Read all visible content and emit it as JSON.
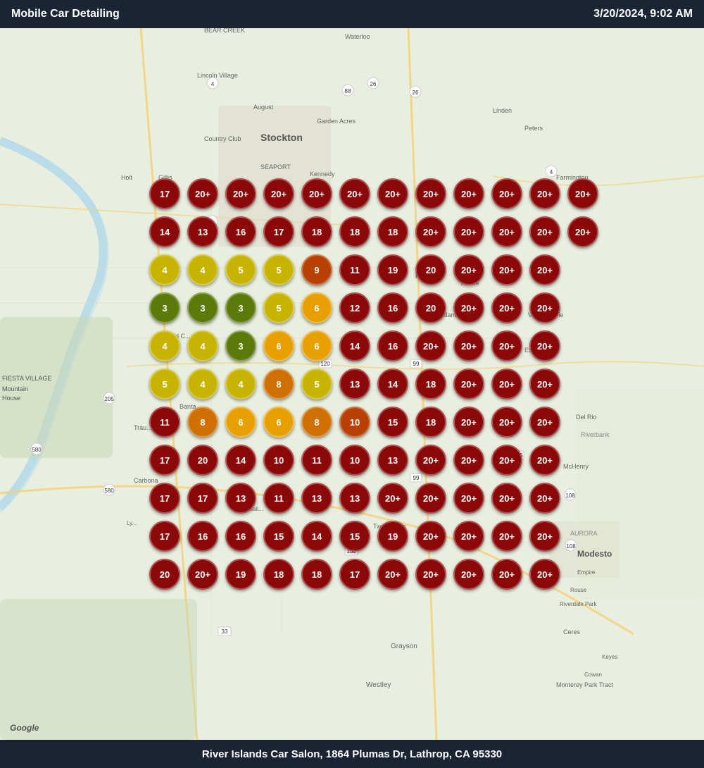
{
  "header": {
    "title": "Mobile Car Detailing",
    "datetime": "3/20/2024, 9:02 AM"
  },
  "footer": {
    "address": "River Islands Car Salon, 1864 Plumas Dr, Lathrop, CA 95330"
  },
  "google_logo": "Google",
  "bubbles": [
    {
      "row": 0,
      "col": 0,
      "val": "17",
      "color": "dark-red"
    },
    {
      "row": 0,
      "col": 1,
      "val": "20+",
      "color": "dark-red"
    },
    {
      "row": 0,
      "col": 2,
      "val": "20+",
      "color": "dark-red"
    },
    {
      "row": 0,
      "col": 3,
      "val": "20+",
      "color": "dark-red"
    },
    {
      "row": 0,
      "col": 4,
      "val": "20+",
      "color": "dark-red"
    },
    {
      "row": 0,
      "col": 5,
      "val": "20+",
      "color": "dark-red"
    },
    {
      "row": 0,
      "col": 6,
      "val": "20+",
      "color": "dark-red"
    },
    {
      "row": 0,
      "col": 7,
      "val": "20+",
      "color": "dark-red"
    },
    {
      "row": 0,
      "col": 8,
      "val": "20+",
      "color": "dark-red"
    },
    {
      "row": 0,
      "col": 9,
      "val": "20+",
      "color": "dark-red"
    },
    {
      "row": 0,
      "col": 10,
      "val": "20+",
      "color": "dark-red"
    },
    {
      "row": 0,
      "col": 11,
      "val": "20+",
      "color": "dark-red"
    },
    {
      "row": 1,
      "col": 0,
      "val": "14",
      "color": "dark-red"
    },
    {
      "row": 1,
      "col": 1,
      "val": "13",
      "color": "dark-red"
    },
    {
      "row": 1,
      "col": 2,
      "val": "16",
      "color": "dark-red"
    },
    {
      "row": 1,
      "col": 3,
      "val": "17",
      "color": "dark-red"
    },
    {
      "row": 1,
      "col": 4,
      "val": "18",
      "color": "dark-red"
    },
    {
      "row": 1,
      "col": 5,
      "val": "18",
      "color": "dark-red"
    },
    {
      "row": 1,
      "col": 6,
      "val": "18",
      "color": "dark-red"
    },
    {
      "row": 1,
      "col": 7,
      "val": "20+",
      "color": "dark-red"
    },
    {
      "row": 1,
      "col": 8,
      "val": "20+",
      "color": "dark-red"
    },
    {
      "row": 1,
      "col": 9,
      "val": "20+",
      "color": "dark-red"
    },
    {
      "row": 1,
      "col": 10,
      "val": "20+",
      "color": "dark-red"
    },
    {
      "row": 1,
      "col": 11,
      "val": "20+",
      "color": "dark-red"
    },
    {
      "row": 2,
      "col": 0,
      "val": "4",
      "color": "yellow"
    },
    {
      "row": 2,
      "col": 1,
      "val": "4",
      "color": "yellow"
    },
    {
      "row": 2,
      "col": 2,
      "val": "5",
      "color": "yellow"
    },
    {
      "row": 2,
      "col": 3,
      "val": "5",
      "color": "yellow"
    },
    {
      "row": 2,
      "col": 4,
      "val": "9",
      "color": "dark-orange"
    },
    {
      "row": 2,
      "col": 5,
      "val": "11",
      "color": "dark-red"
    },
    {
      "row": 2,
      "col": 6,
      "val": "19",
      "color": "dark-red"
    },
    {
      "row": 2,
      "col": 7,
      "val": "20",
      "color": "dark-red"
    },
    {
      "row": 2,
      "col": 8,
      "val": "20+",
      "color": "dark-red"
    },
    {
      "row": 2,
      "col": 9,
      "val": "20+",
      "color": "dark-red"
    },
    {
      "row": 2,
      "col": 10,
      "val": "20+",
      "color": "dark-red"
    },
    {
      "row": 3,
      "col": 0,
      "val": "3",
      "color": "olive"
    },
    {
      "row": 3,
      "col": 1,
      "val": "3",
      "color": "olive"
    },
    {
      "row": 3,
      "col": 2,
      "val": "3",
      "color": "olive"
    },
    {
      "row": 3,
      "col": 3,
      "val": "5",
      "color": "yellow"
    },
    {
      "row": 3,
      "col": 4,
      "val": "6",
      "color": "light-orange"
    },
    {
      "row": 3,
      "col": 5,
      "val": "12",
      "color": "dark-red"
    },
    {
      "row": 3,
      "col": 6,
      "val": "16",
      "color": "dark-red"
    },
    {
      "row": 3,
      "col": 7,
      "val": "20",
      "color": "dark-red"
    },
    {
      "row": 3,
      "col": 8,
      "val": "20+",
      "color": "dark-red"
    },
    {
      "row": 3,
      "col": 9,
      "val": "20+",
      "color": "dark-red"
    },
    {
      "row": 3,
      "col": 10,
      "val": "20+",
      "color": "dark-red"
    },
    {
      "row": 4,
      "col": 0,
      "val": "4",
      "color": "yellow"
    },
    {
      "row": 4,
      "col": 1,
      "val": "4",
      "color": "yellow"
    },
    {
      "row": 4,
      "col": 2,
      "val": "3",
      "color": "olive"
    },
    {
      "row": 4,
      "col": 3,
      "val": "6",
      "color": "light-orange"
    },
    {
      "row": 4,
      "col": 4,
      "val": "6",
      "color": "light-orange"
    },
    {
      "row": 4,
      "col": 5,
      "val": "14",
      "color": "dark-red"
    },
    {
      "row": 4,
      "col": 6,
      "val": "16",
      "color": "dark-red"
    },
    {
      "row": 4,
      "col": 7,
      "val": "20+",
      "color": "dark-red"
    },
    {
      "row": 4,
      "col": 8,
      "val": "20+",
      "color": "dark-red"
    },
    {
      "row": 4,
      "col": 9,
      "val": "20+",
      "color": "dark-red"
    },
    {
      "row": 4,
      "col": 10,
      "val": "20+",
      "color": "dark-red"
    },
    {
      "row": 5,
      "col": 0,
      "val": "5",
      "color": "yellow"
    },
    {
      "row": 5,
      "col": 1,
      "val": "4",
      "color": "yellow"
    },
    {
      "row": 5,
      "col": 2,
      "val": "4",
      "color": "yellow"
    },
    {
      "row": 5,
      "col": 3,
      "val": "8",
      "color": "orange"
    },
    {
      "row": 5,
      "col": 4,
      "val": "5",
      "color": "yellow"
    },
    {
      "row": 5,
      "col": 5,
      "val": "13",
      "color": "dark-red"
    },
    {
      "row": 5,
      "col": 6,
      "val": "14",
      "color": "dark-red"
    },
    {
      "row": 5,
      "col": 7,
      "val": "18",
      "color": "dark-red"
    },
    {
      "row": 5,
      "col": 8,
      "val": "20+",
      "color": "dark-red"
    },
    {
      "row": 5,
      "col": 9,
      "val": "20+",
      "color": "dark-red"
    },
    {
      "row": 5,
      "col": 10,
      "val": "20+",
      "color": "dark-red"
    },
    {
      "row": 6,
      "col": 0,
      "val": "11",
      "color": "dark-red"
    },
    {
      "row": 6,
      "col": 1,
      "val": "8",
      "color": "orange"
    },
    {
      "row": 6,
      "col": 2,
      "val": "6",
      "color": "light-orange"
    },
    {
      "row": 6,
      "col": 3,
      "val": "6",
      "color": "light-orange"
    },
    {
      "row": 6,
      "col": 4,
      "val": "8",
      "color": "orange"
    },
    {
      "row": 6,
      "col": 5,
      "val": "10",
      "color": "dark-orange"
    },
    {
      "row": 6,
      "col": 6,
      "val": "15",
      "color": "dark-red"
    },
    {
      "row": 6,
      "col": 7,
      "val": "18",
      "color": "dark-red"
    },
    {
      "row": 6,
      "col": 8,
      "val": "20+",
      "color": "dark-red"
    },
    {
      "row": 6,
      "col": 9,
      "val": "20+",
      "color": "dark-red"
    },
    {
      "row": 6,
      "col": 10,
      "val": "20+",
      "color": "dark-red"
    },
    {
      "row": 7,
      "col": 0,
      "val": "17",
      "color": "dark-red"
    },
    {
      "row": 7,
      "col": 1,
      "val": "20",
      "color": "dark-red"
    },
    {
      "row": 7,
      "col": 2,
      "val": "14",
      "color": "dark-red"
    },
    {
      "row": 7,
      "col": 3,
      "val": "10",
      "color": "dark-red"
    },
    {
      "row": 7,
      "col": 4,
      "val": "11",
      "color": "dark-red"
    },
    {
      "row": 7,
      "col": 5,
      "val": "10",
      "color": "dark-red"
    },
    {
      "row": 7,
      "col": 6,
      "val": "13",
      "color": "dark-red"
    },
    {
      "row": 7,
      "col": 7,
      "val": "20+",
      "color": "dark-red"
    },
    {
      "row": 7,
      "col": 8,
      "val": "20+",
      "color": "dark-red"
    },
    {
      "row": 7,
      "col": 9,
      "val": "20+",
      "color": "dark-red"
    },
    {
      "row": 7,
      "col": 10,
      "val": "20+",
      "color": "dark-red"
    },
    {
      "row": 8,
      "col": 0,
      "val": "17",
      "color": "dark-red"
    },
    {
      "row": 8,
      "col": 1,
      "val": "17",
      "color": "dark-red"
    },
    {
      "row": 8,
      "col": 2,
      "val": "13",
      "color": "dark-red"
    },
    {
      "row": 8,
      "col": 3,
      "val": "11",
      "color": "dark-red"
    },
    {
      "row": 8,
      "col": 4,
      "val": "13",
      "color": "dark-red"
    },
    {
      "row": 8,
      "col": 5,
      "val": "13",
      "color": "dark-red"
    },
    {
      "row": 8,
      "col": 6,
      "val": "20+",
      "color": "dark-red"
    },
    {
      "row": 8,
      "col": 7,
      "val": "20+",
      "color": "dark-red"
    },
    {
      "row": 8,
      "col": 8,
      "val": "20+",
      "color": "dark-red"
    },
    {
      "row": 8,
      "col": 9,
      "val": "20+",
      "color": "dark-red"
    },
    {
      "row": 8,
      "col": 10,
      "val": "20+",
      "color": "dark-red"
    },
    {
      "row": 9,
      "col": 0,
      "val": "17",
      "color": "dark-red"
    },
    {
      "row": 9,
      "col": 1,
      "val": "16",
      "color": "dark-red"
    },
    {
      "row": 9,
      "col": 2,
      "val": "16",
      "color": "dark-red"
    },
    {
      "row": 9,
      "col": 3,
      "val": "15",
      "color": "dark-red"
    },
    {
      "row": 9,
      "col": 4,
      "val": "14",
      "color": "dark-red"
    },
    {
      "row": 9,
      "col": 5,
      "val": "15",
      "color": "dark-red"
    },
    {
      "row": 9,
      "col": 6,
      "val": "19",
      "color": "dark-red"
    },
    {
      "row": 9,
      "col": 7,
      "val": "20+",
      "color": "dark-red"
    },
    {
      "row": 9,
      "col": 8,
      "val": "20+",
      "color": "dark-red"
    },
    {
      "row": 9,
      "col": 9,
      "val": "20+",
      "color": "dark-red"
    },
    {
      "row": 9,
      "col": 10,
      "val": "20+",
      "color": "dark-red"
    },
    {
      "row": 10,
      "col": 0,
      "val": "20",
      "color": "dark-red"
    },
    {
      "row": 10,
      "col": 1,
      "val": "20+",
      "color": "dark-red"
    },
    {
      "row": 10,
      "col": 2,
      "val": "19",
      "color": "dark-red"
    },
    {
      "row": 10,
      "col": 3,
      "val": "18",
      "color": "dark-red"
    },
    {
      "row": 10,
      "col": 4,
      "val": "18",
      "color": "dark-red"
    },
    {
      "row": 10,
      "col": 5,
      "val": "17",
      "color": "dark-red"
    },
    {
      "row": 10,
      "col": 6,
      "val": "20+",
      "color": "dark-red"
    },
    {
      "row": 10,
      "col": 7,
      "val": "20+",
      "color": "dark-red"
    },
    {
      "row": 10,
      "col": 8,
      "val": "20+",
      "color": "dark-red"
    },
    {
      "row": 10,
      "col": 9,
      "val": "20+",
      "color": "dark-red"
    },
    {
      "row": 10,
      "col": 10,
      "val": "20+",
      "color": "dark-red"
    }
  ],
  "colors": {
    "yellow": "#c8b400",
    "yellow-green": "#8db300",
    "olive": "#5a7a00",
    "light-orange": "#e8a000",
    "orange": "#d07000",
    "dark-orange": "#b84000",
    "red": "#a01010",
    "dark-red": "#8b0000"
  }
}
